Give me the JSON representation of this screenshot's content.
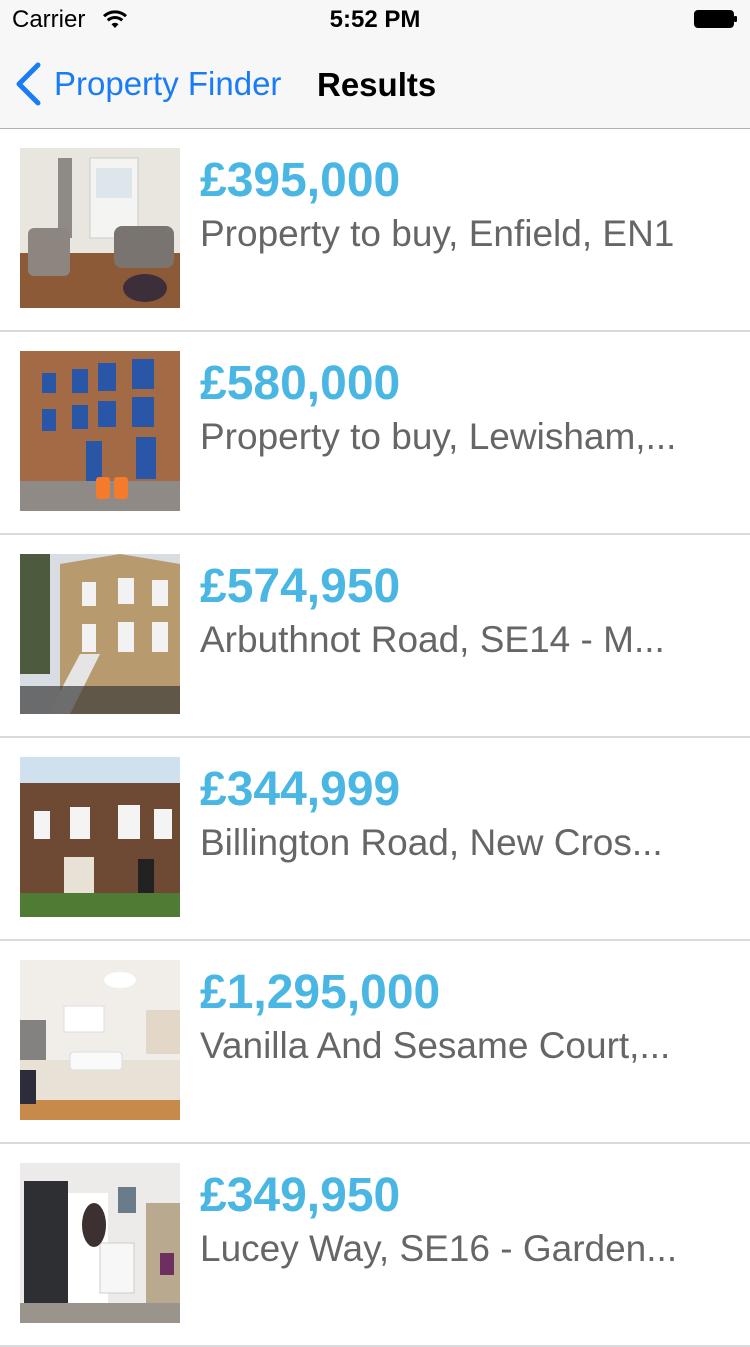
{
  "status_bar": {
    "carrier": "Carrier",
    "time": "5:52 PM"
  },
  "nav": {
    "back_label": "Property Finder",
    "title": "Results",
    "accent_color": "#1a7cf5"
  },
  "colors": {
    "price": "#49b6e4",
    "title": "#666666"
  },
  "results": [
    {
      "price": "£395,000",
      "title": "Property to buy, Enfield, EN1"
    },
    {
      "price": "£580,000",
      "title": "Property to buy, Lewisham,..."
    },
    {
      "price": "£574,950",
      "title": "Arbuthnot Road, SE14 - M..."
    },
    {
      "price": "£344,999",
      "title": "Billington Road, New Cros..."
    },
    {
      "price": "£1,295,000",
      "title": "Vanilla And Sesame Court,..."
    },
    {
      "price": "£349,950",
      "title": "Lucey Way, SE16 - Garden..."
    }
  ]
}
